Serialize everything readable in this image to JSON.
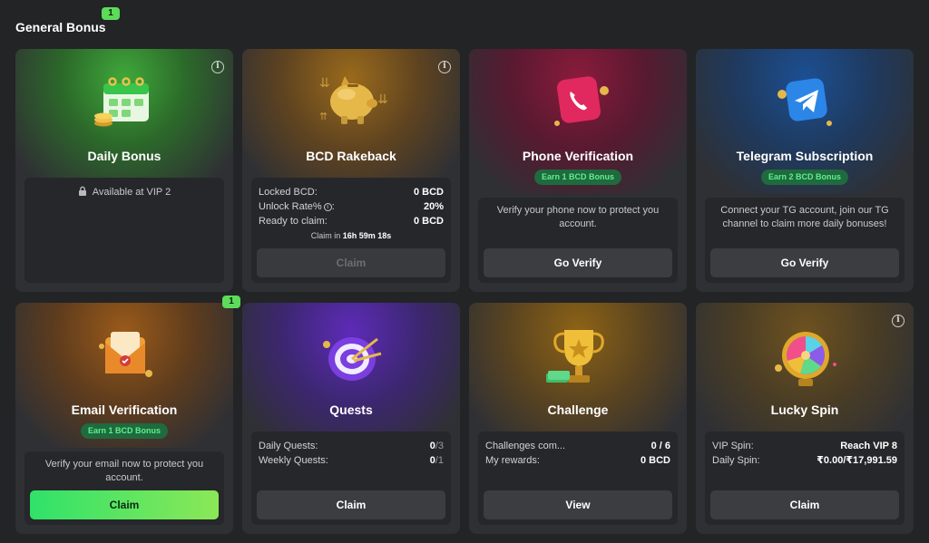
{
  "section": {
    "title": "General Bonus",
    "badge": "1"
  },
  "cards": [
    {
      "title": "Daily Bonus",
      "lock_text": "Available at VIP 2"
    },
    {
      "title": "BCD Rakeback",
      "rows": [
        {
          "label": "Locked BCD:",
          "value": "0 BCD"
        },
        {
          "label": "Unlock Rate%",
          "value": "20%"
        },
        {
          "label": "Ready to claim:",
          "value": "0 BCD"
        }
      ],
      "timer_prefix": "Claim in",
      "timer_value": "16h 59m 18s",
      "button": "Claim"
    },
    {
      "title": "Phone Verification",
      "pill": "Earn 1 BCD Bonus",
      "message": "Verify your phone now to protect you account.",
      "button": "Go Verify"
    },
    {
      "title": "Telegram Subscription",
      "pill": "Earn 2 BCD Bonus",
      "message": "Connect your TG account, join our TG channel to claim more daily bonuses!",
      "button": "Go Verify"
    },
    {
      "title": "Email Verification",
      "badge": "1",
      "pill": "Earn 1 BCD Bonus",
      "message": "Verify your email now to protect you account.",
      "button": "Claim"
    },
    {
      "title": "Quests",
      "rows": [
        {
          "label": "Daily Quests:",
          "value": "0",
          "value_dim": "/3"
        },
        {
          "label": "Weekly Quests:",
          "value": "0",
          "value_dim": "/1"
        }
      ],
      "button": "Claim"
    },
    {
      "title": "Challenge",
      "rows": [
        {
          "label": "Challenges com...",
          "value": "0 / 6"
        },
        {
          "label": "My rewards:",
          "value": "0 BCD"
        }
      ],
      "button": "View"
    },
    {
      "title": "Lucky Spin",
      "rows": [
        {
          "label": "VIP Spin:",
          "value": "Reach VIP 8"
        },
        {
          "label": "Daily Spin:",
          "value": "₹0.00/₹17,991.59"
        }
      ],
      "button": "Claim"
    }
  ],
  "colors": {
    "accent_green": "#5cdc5a",
    "daily_glow": "#3fa83a",
    "rakeback_glow": "#9a6a1c",
    "phone_glow": "#8a1b3c",
    "telegram_glow": "#1c4f92",
    "email_glow": "#9a5a1a",
    "quests_glow": "#5d2bb8",
    "challenge_glow": "#8d6316",
    "spin_glow": "#6e5220"
  }
}
